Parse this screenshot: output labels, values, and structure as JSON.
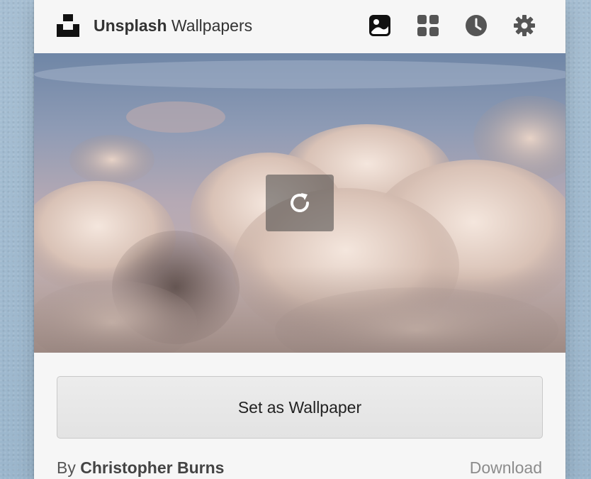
{
  "app": {
    "title_bold": "Unsplash",
    "title_regular": "Wallpapers"
  },
  "toolbar": {
    "icons": [
      "photo-icon",
      "grid-icon",
      "clock-icon",
      "gear-icon"
    ],
    "active_icon": "photo-icon"
  },
  "photo": {
    "refresh_icon": "refresh-icon"
  },
  "actions": {
    "set_wallpaper_label": "Set as Wallpaper",
    "download_label": "Download"
  },
  "credit": {
    "prefix": "By",
    "author": "Christopher Burns"
  },
  "colors": {
    "accent": "#222222",
    "muted": "#8c8c8c",
    "panel": "#f6f6f6"
  }
}
